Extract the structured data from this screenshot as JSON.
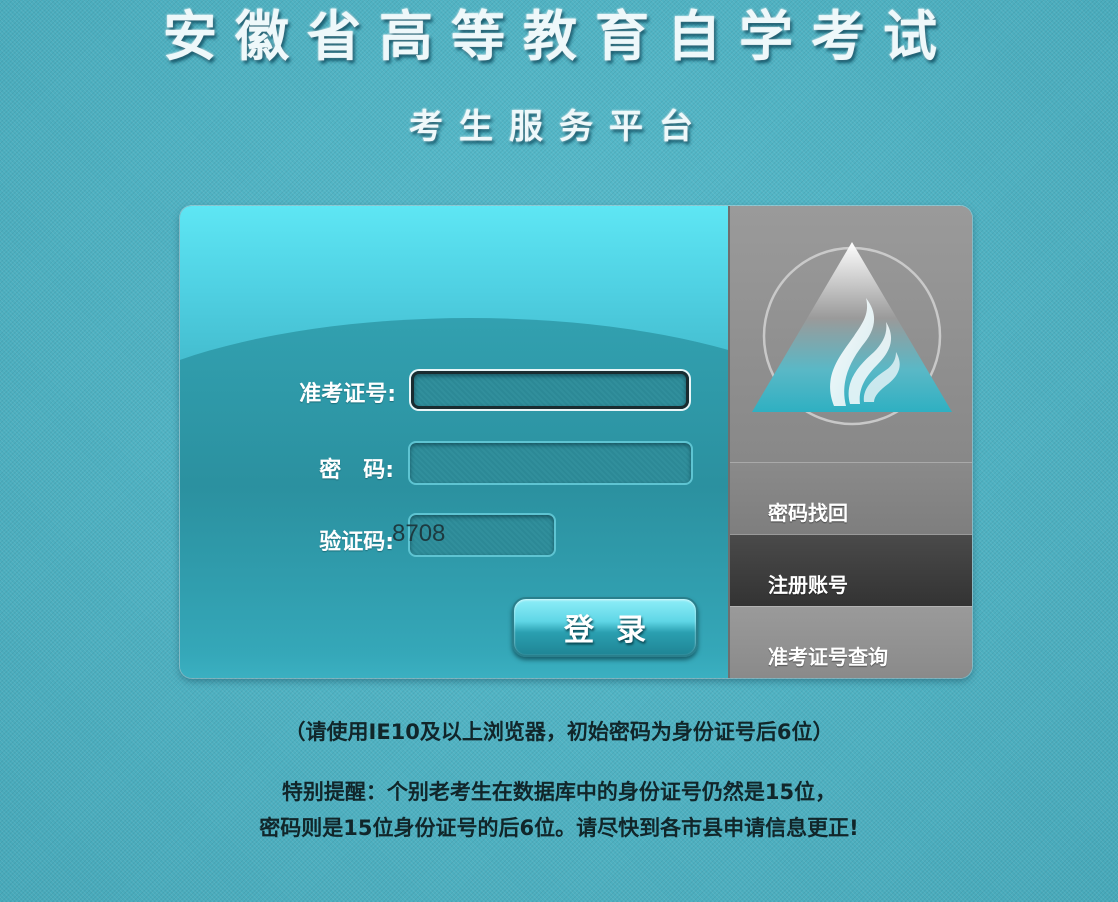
{
  "header": {
    "title": "安徽省高等教育自学考试",
    "subtitle": "考生服务平台"
  },
  "login": {
    "labels": {
      "ticket": "准考证号:",
      "password": "密　码:",
      "captcha": "验证码:"
    },
    "inputs": {
      "ticket_value": "",
      "password_value": "",
      "captcha_value": ""
    },
    "captcha_code": "8708",
    "submit_label": "登录"
  },
  "sidebar": {
    "links": [
      {
        "label": "密码找回"
      },
      {
        "label": "注册账号"
      },
      {
        "label": "准考证号查询"
      }
    ]
  },
  "footer": {
    "notice": "（请使用IE10及以上浏览器，初始密码为身份证号后6位）",
    "warning_line1": "特别提醒：个别老考生在数据库中的身份证号仍然是15位，",
    "warning_line2": "密码则是15位身份证号的后6位。请尽快到各市县申请信息更正!"
  },
  "colors": {
    "background": "#4fb3c4",
    "panel_top": "#5ee6f4",
    "panel_mid": "#339ead",
    "sidebar": "#888888",
    "sidebar_active": "#3a3a3a",
    "logo_teal": "#3fb8c8"
  }
}
